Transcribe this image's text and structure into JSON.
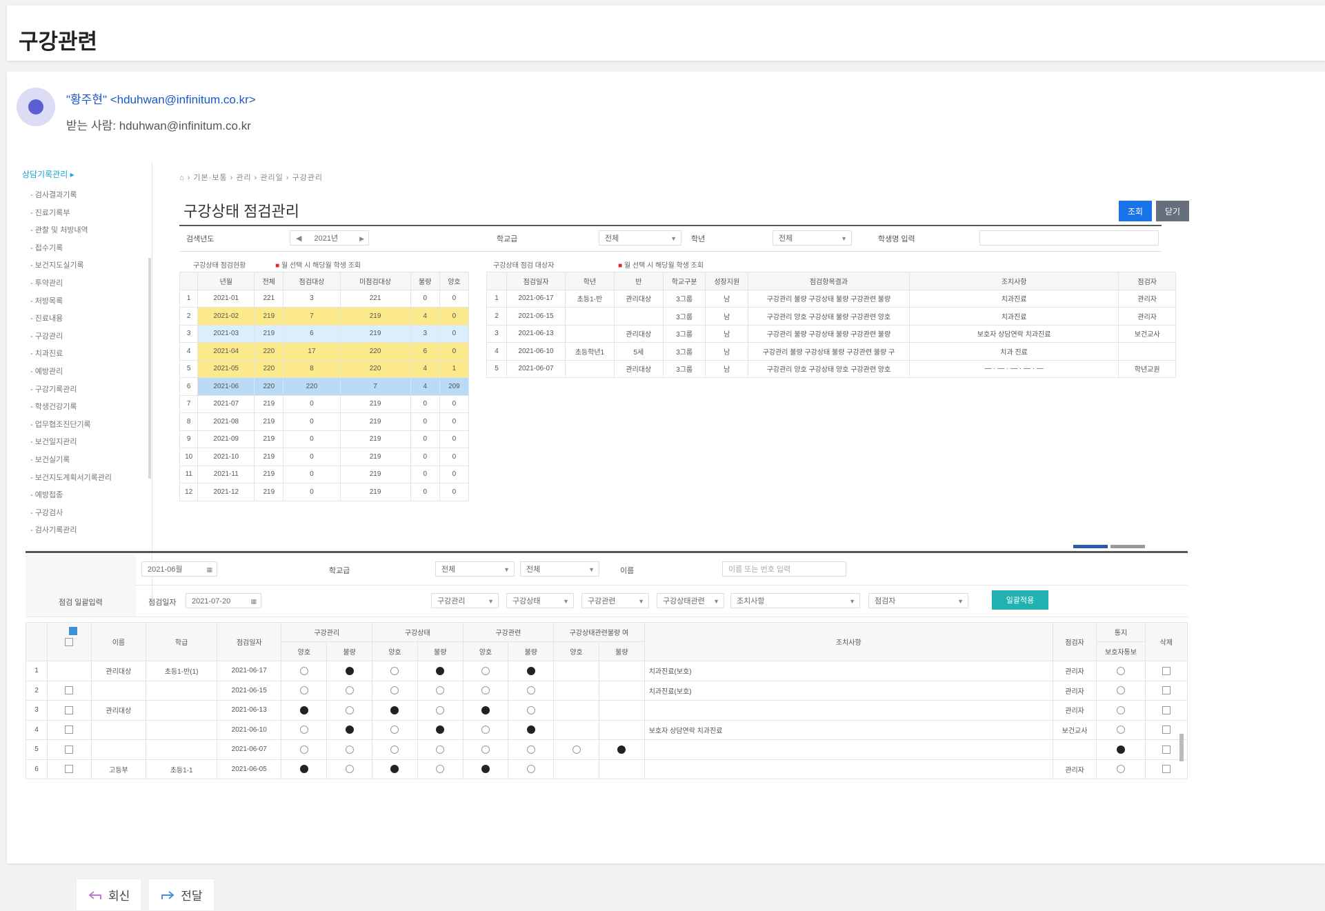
{
  "page": {
    "title": "구강관련"
  },
  "mail": {
    "from": "\"황주현\" <hduhwan@infinitum.co.kr>",
    "to": "받는 사람: hduhwan@infinitum.co.kr"
  },
  "sidebar": {
    "head": "상담기록관리 ▸",
    "items": [
      "- 검사결과기록",
      "- 진료기록부",
      "- 관찰 및 처방내역",
      "- 접수기록",
      "- 보건지도실기록",
      "- 투약관리",
      "- 처방목록",
      "- 진료내용",
      "- 구강관리",
      "- 치과진료",
      "- 예방관리",
      "- 구강기록관리",
      "- 학생건강기록",
      "- 업무협조진단기록",
      "- 보건일지관리",
      "- 보건실기록",
      "- 보건지도계획서기록관리",
      "- 예방접종",
      "- 구강검사",
      "- 검사기록관리"
    ]
  },
  "breadcrumb": "⌂ › 기본·보통 › 관리 › 관리일 › 구강관리",
  "content": {
    "title": "구강상태 점검관리",
    "btn_search": "조회",
    "btn_close": "닫기",
    "filter": {
      "year_label": "검색년도",
      "year_value": "2021년",
      "school_label": "학교급",
      "school_value": "전체",
      "grade_label": "학년",
      "grade_value": "전체",
      "name_label": "학생명 입력"
    },
    "left_caption": "구강상태 점검현황",
    "left_note": "월 선택 시 해당월 학생 조회",
    "right_caption": "구강상태 점검 대상자",
    "right_note": "월 선택 시 해당월 학생 조회"
  },
  "table1": {
    "headers": [
      "",
      "년월",
      "전체",
      "점검대상",
      "미점검대상",
      "불량",
      "양호"
    ],
    "rows": [
      {
        "n": "1",
        "cells": [
          "2021-01",
          "221",
          "3",
          "221",
          "0",
          "0"
        ],
        "style": ""
      },
      {
        "n": "2",
        "cells": [
          "2021-02",
          "219",
          "7",
          "219",
          "4",
          "0"
        ],
        "style": "yellow"
      },
      {
        "n": "3",
        "cells": [
          "2021-03",
          "219",
          "6",
          "219",
          "3",
          "0"
        ],
        "style": "lightblue"
      },
      {
        "n": "4",
        "cells": [
          "2021-04",
          "220",
          "17",
          "220",
          "6",
          "0"
        ],
        "style": "yellow"
      },
      {
        "n": "5",
        "cells": [
          "2021-05",
          "220",
          "8",
          "220",
          "4",
          "1"
        ],
        "style": "yellow"
      },
      {
        "n": "6",
        "cells": [
          "2021-06",
          "220",
          "220",
          "7",
          "4",
          "209"
        ],
        "style": "blue"
      },
      {
        "n": "7",
        "cells": [
          "2021-07",
          "219",
          "0",
          "219",
          "0",
          "0"
        ],
        "style": ""
      },
      {
        "n": "8",
        "cells": [
          "2021-08",
          "219",
          "0",
          "219",
          "0",
          "0"
        ],
        "style": ""
      },
      {
        "n": "9",
        "cells": [
          "2021-09",
          "219",
          "0",
          "219",
          "0",
          "0"
        ],
        "style": ""
      },
      {
        "n": "10",
        "cells": [
          "2021-10",
          "219",
          "0",
          "219",
          "0",
          "0"
        ],
        "style": ""
      },
      {
        "n": "11",
        "cells": [
          "2021-11",
          "219",
          "0",
          "219",
          "0",
          "0"
        ],
        "style": ""
      },
      {
        "n": "12",
        "cells": [
          "2021-12",
          "219",
          "0",
          "219",
          "0",
          "0"
        ],
        "style": ""
      }
    ]
  },
  "table2": {
    "headers": [
      "",
      "점검일자",
      "학년",
      "반",
      "학교구분",
      "성장지원",
      "점검항목결과",
      "조치사항",
      "점검자"
    ],
    "rows": [
      {
        "n": "1",
        "cells": [
          "2021-06-17",
          "초등1-반",
          "관리대상",
          "3그룹",
          "남",
          "구강관리 불량 구강상태 불량 구강관련 불량",
          "치과진료",
          "관리자"
        ]
      },
      {
        "n": "2",
        "cells": [
          "2021-06-15",
          "",
          "",
          "3그룹",
          "남",
          "구강관리 양호 구강상태 불량 구강관련 양호",
          "치과진료",
          "관리자"
        ]
      },
      {
        "n": "3",
        "cells": [
          "2021-06-13",
          "",
          "관리대상",
          "3그룹",
          "남",
          "구강관리 불량 구강상태 불량 구강관련 불량",
          "보호자 상담연락 치과진료",
          "보건교사"
        ]
      },
      {
        "n": "4",
        "cells": [
          "2021-06-10",
          "초등학년1",
          "5세",
          "3그룹",
          "남",
          "구강관리 불량 구강상태 불량 구강관련 불량 구",
          "치과 진료",
          ""
        ]
      },
      {
        "n": "5",
        "cells": [
          "2021-06-07",
          "",
          "관리대상",
          "3그룹",
          "남",
          "구강관리 양호 구강상태 양호 구강관련 양호",
          "— · — · — · — · —",
          "학년교원"
        ]
      }
    ]
  },
  "filter2": {
    "month_value": "2021-06월",
    "school_label": "학교급",
    "sel1": "전체",
    "sel2": "전체",
    "name_label": "이름",
    "name_placeholder": "이름 또는 번호 입력",
    "section_label": "점검 일괄입력",
    "date_label": "점검일자",
    "date_value": "2021-07-20",
    "s1": "구강관리",
    "s2": "구강상태",
    "s3": "구강관련",
    "s4": "구강상태관련",
    "s5": "조치사항",
    "s6": "점검자",
    "apply": "일괄적용"
  },
  "table3": {
    "groups": [
      "구강관리",
      "구강상태",
      "구강관련",
      "구강상태관련불량 여"
    ],
    "sub": [
      "양호",
      "불량"
    ],
    "h_name": "이름",
    "h_class": "학급",
    "h_date": "점검일자",
    "h_action": "조치사항",
    "h_checker": "점검자",
    "h_send1": "통지",
    "h_send2": "보호자통보",
    "h_del": "삭제",
    "rows": [
      {
        "n": "1",
        "name": "관리대상",
        "cls": "초등1-반(1)",
        "date": "2021-06-17",
        "v": [
          0,
          1,
          0,
          1,
          0,
          1,
          -1,
          -1
        ],
        "act": "치과진료(보호)",
        "chk": "관리자",
        "send": 0,
        "sel": true
      },
      {
        "n": "2",
        "name": "",
        "cls": "",
        "date": "2021-06-15",
        "v": [
          0,
          0,
          0,
          0,
          0,
          0,
          -1,
          -1
        ],
        "act": "치과진료(보호)",
        "chk": "관리자",
        "send": 0,
        "sel": false
      },
      {
        "n": "3",
        "name": "관리대상",
        "cls": "",
        "date": "2021-06-13",
        "v": [
          1,
          0,
          1,
          0,
          1,
          0,
          -1,
          -1
        ],
        "act": "",
        "chk": "관리자",
        "send": 0,
        "sel": false
      },
      {
        "n": "4",
        "name": "",
        "cls": "",
        "date": "2021-06-10",
        "v": [
          0,
          1,
          0,
          1,
          0,
          1,
          -1,
          -1
        ],
        "act": "보호자 상담연락 치과진료",
        "chk": "보건교사",
        "send": 0,
        "sel": false
      },
      {
        "n": "5",
        "name": "",
        "cls": "",
        "date": "2021-06-07",
        "v": [
          0,
          0,
          0,
          0,
          0,
          0,
          0,
          1
        ],
        "act": "",
        "chk": "",
        "send": 1,
        "sel": false
      },
      {
        "n": "6",
        "name": "고등부",
        "cls": "초등1-1",
        "date": "2021-06-05",
        "v": [
          1,
          0,
          1,
          0,
          1,
          0,
          -1,
          -1
        ],
        "act": "",
        "chk": "관리자",
        "send": 0,
        "sel": false
      }
    ]
  },
  "bottom": {
    "reply": "회신",
    "forward": "전달"
  }
}
